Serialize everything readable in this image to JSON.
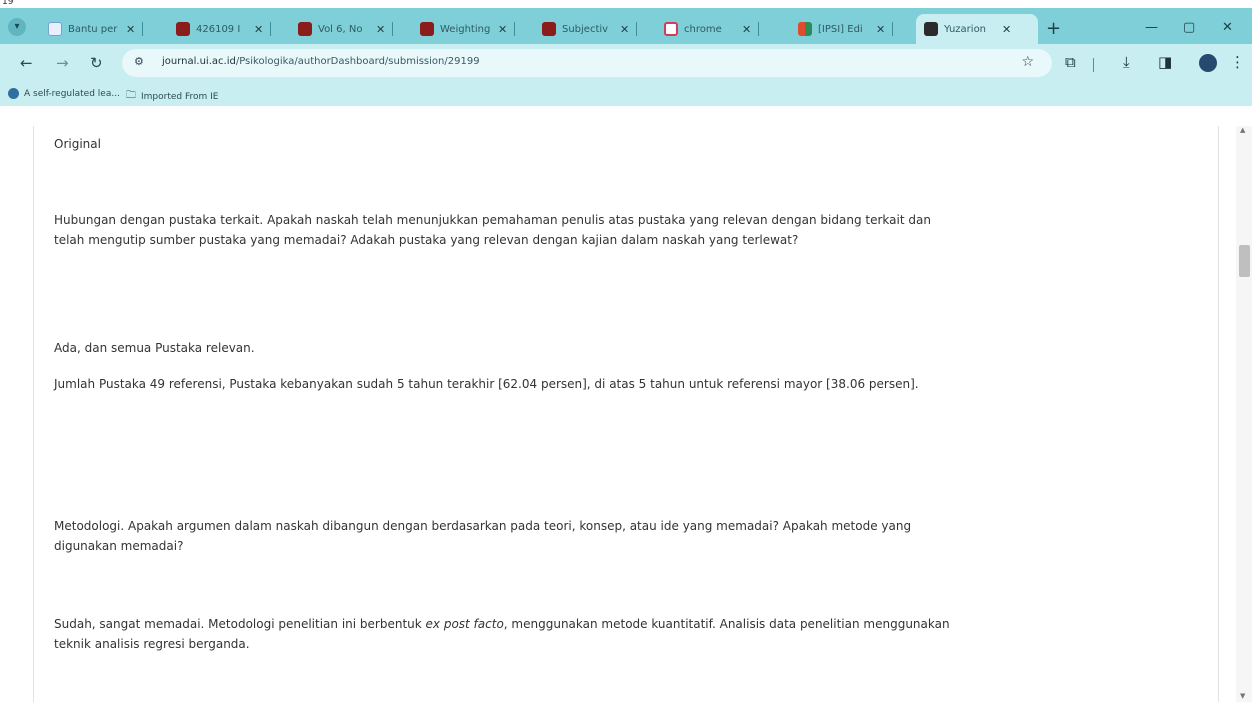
{
  "window": {
    "corner_label": "19",
    "tabs": [
      {
        "title": "Bantu per",
        "favicon_color": "#e8f0ff"
      },
      {
        "title": "426109 I",
        "favicon_color": "#8a1c1c"
      },
      {
        "title": "Vol 6, No",
        "favicon_color": "#8a1c1c"
      },
      {
        "title": "Weighting",
        "favicon_color": "#8a1c1c"
      },
      {
        "title": "Subjectiv",
        "favicon_color": "#8a1c1c"
      },
      {
        "title": "chrome",
        "favicon_color": "#d33b5a"
      },
      {
        "title": "[IPSI] Edi",
        "favicon_color": "#2e8b57"
      },
      {
        "title": "Yuzarion",
        "favicon_color": "#2b2b2b"
      }
    ],
    "close_glyph": "✕",
    "new_tab_glyph": "+",
    "minimize_glyph": "—",
    "maximize_glyph": "▢",
    "close_window_glyph": "✕"
  },
  "address_bar": {
    "domain": "journal.ui.ac.id",
    "path": "/Psikologika/authorDashboard/submission/29199"
  },
  "bookmarks": [
    {
      "label": "A self-regulated lea...",
      "icon": "globe-icon"
    },
    {
      "label": "Imported From IE",
      "icon": "folder-icon"
    }
  ],
  "content": {
    "paragraphs": [
      {
        "text": "Original"
      },
      {
        "text": "Hubungan dengan pustaka terkait. Apakah naskah telah menunjukkan pemahaman penulis atas pustaka yang relevan dengan bidang terkait dan telah mengutip sumber pustaka yang memadai? Adakah pustaka yang relevan dengan kajian dalam naskah yang terlewat?"
      },
      {
        "text": "Ada, dan semua Pustaka relevan."
      },
      {
        "text": "Jumlah Pustaka 49 referensi, Pustaka kebanyakan sudah 5 tahun terakhir [62.04 persen], di atas 5 tahun untuk referensi mayor [38.06 persen]."
      },
      {
        "text": "Metodologi. Apakah argumen dalam naskah dibangun dengan berdasarkan pada teori, konsep, atau ide yang memadai? Apakah metode yang digunakan memadai?"
      },
      {
        "before": "Sudah, sangat memadai. Metodologi penelitian ini berbentuk ",
        "italic": "ex post facto",
        "after": ", menggunakan metode kuantitatif. Analisis data penelitian menggunakan teknik analisis regresi berganda."
      }
    ]
  }
}
